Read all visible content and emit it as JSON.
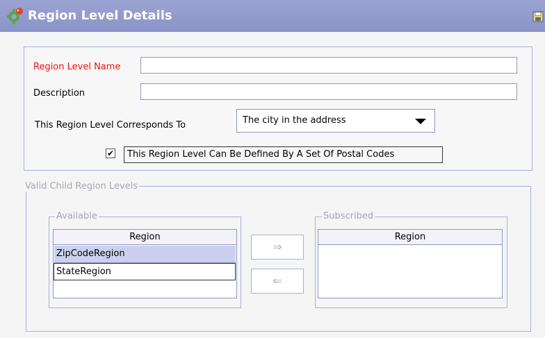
{
  "header": {
    "title": "Region Level Details",
    "icon": "region-gear-icon",
    "save_icon": "save-icon"
  },
  "form": {
    "name_label": "Region Level Name",
    "name_value": "",
    "description_label": "Description",
    "description_value": "",
    "corresponds_label": "This Region Level Corresponds To",
    "corresponds_value": "The city in the address",
    "postal_checkbox_label": "This Region Level Can Be Defined By A Set Of Postal Codes",
    "postal_checked": true,
    "checkmark": "✔"
  },
  "child_levels": {
    "legend": "Valid Child Region Levels",
    "available": {
      "legend": "Available",
      "column": "Region",
      "rows": [
        "ZipCodeRegion",
        "StateRegion"
      ]
    },
    "subscribed": {
      "legend": "Subscribed",
      "column": "Region",
      "rows": []
    },
    "add_arrow": "⇒",
    "remove_arrow": "⇐"
  },
  "colors": {
    "title_bar": "#8a94c8",
    "required_label": "#ee1111",
    "border": "#a8afd8",
    "selected_row": "#ccd0ee"
  }
}
